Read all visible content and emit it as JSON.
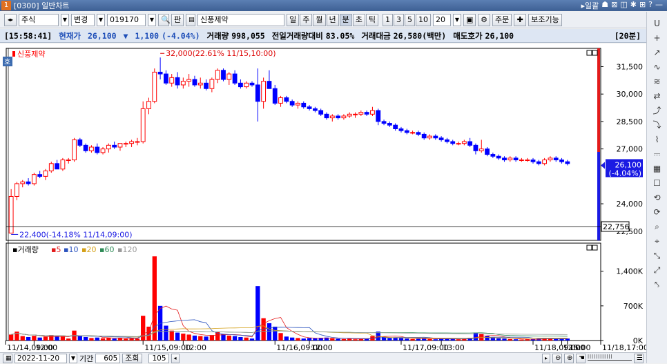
{
  "window": {
    "number": "1",
    "title": "[0300] 일반차트",
    "right_items": [
      "▸일괄",
      "☗",
      "⊠",
      "◫",
      "✱",
      "⊞",
      "?",
      "—"
    ]
  },
  "toolbar": {
    "arrows": "◂▸",
    "market_type": "주식",
    "change_label": "변경",
    "stock_code": "019170",
    "stock_name": "신풍제약",
    "pan_label": "판",
    "period_buttons": [
      "일",
      "주",
      "월",
      "년",
      "분",
      "초",
      "틱"
    ],
    "active_period": "분",
    "interval_buttons": [
      "1",
      "3",
      "5",
      "10"
    ],
    "interval_value": "20",
    "order_label": "주문",
    "aux_label": "보조기능"
  },
  "infobar": {
    "time": "[15:58:41]",
    "price_label": "현재가",
    "price": "26,100",
    "change_symbol": "▼",
    "change": "1,100",
    "change_pct": "(-4.04%)",
    "volume_label": "거래량",
    "volume": "998,055",
    "prev_vol_label": "전일거래량대비",
    "prev_vol": "83.05%",
    "amount_label": "거래대금",
    "amount": "26,580(백만)",
    "ask_label": "매도호가",
    "ask": "26,100",
    "interval_tag": "[20분]"
  },
  "chart": {
    "price_legend": "신풍제약",
    "high_annotation": "32,000(22.61% 11/15,10:00)",
    "low_annotation": "22,400(-14.18% 11/14,09:00)",
    "current_price_tag": "26,100",
    "current_pct_tag": "(-4.04%)",
    "crosshair_price": "22,756",
    "price_ticks": [
      "31,500",
      "30,000",
      "28,500",
      "27,000",
      "24,000",
      "22,500"
    ],
    "volume_legend": {
      "label": "거래량",
      "ma": [
        "5",
        "10",
        "20",
        "60",
        "120"
      ]
    },
    "volume_ticks": [
      "1,400K",
      "700K",
      "0K"
    ],
    "x_labels": [
      "11/14,09:00",
      "12:00",
      "11/15,09:00",
      "12:00",
      "11/16,09:00",
      "12:00",
      "11/17,09:00",
      "13:00",
      "11/18,09:00",
      "12:00",
      "15:00",
      "11/18,17:00"
    ]
  },
  "bottombar": {
    "date": "2022-11-20",
    "period_label": "기간",
    "period_value": "605",
    "query_label": "조회",
    "count_value": "105"
  },
  "colors": {
    "up": "#ff0000",
    "down": "#0000ff",
    "accent": "#1f4fb8"
  },
  "chart_data": {
    "type": "candlestick",
    "price_ylim": [
      22000,
      32500
    ],
    "volume_ylim": [
      0,
      1800000
    ],
    "candles": [
      [
        22400,
        24800,
        22400,
        24400,
        120000
      ],
      [
        24400,
        25200,
        24200,
        25100,
        180000
      ],
      [
        25100,
        25300,
        24900,
        25200,
        90000
      ],
      [
        25200,
        25400,
        25000,
        25100,
        70000
      ],
      [
        25100,
        25700,
        25000,
        25600,
        95000
      ],
      [
        25600,
        25800,
        25400,
        25500,
        60000
      ],
      [
        25500,
        25900,
        25300,
        25800,
        75000
      ],
      [
        25800,
        26300,
        25700,
        26200,
        110000
      ],
      [
        26200,
        26400,
        25900,
        25900,
        80000
      ],
      [
        25900,
        26500,
        25800,
        26400,
        85000
      ],
      [
        26400,
        26500,
        26200,
        26400,
        40000
      ],
      [
        26400,
        27600,
        26300,
        27500,
        200000
      ],
      [
        27500,
        27600,
        27100,
        27200,
        90000
      ],
      [
        27200,
        27300,
        26800,
        26900,
        70000
      ],
      [
        26900,
        27200,
        26800,
        27100,
        50000
      ],
      [
        27100,
        27300,
        26700,
        26800,
        60000
      ],
      [
        26800,
        27100,
        26700,
        27000,
        45000
      ],
      [
        27000,
        27300,
        26800,
        27200,
        55000
      ],
      [
        27200,
        27400,
        27000,
        27100,
        40000
      ],
      [
        27100,
        27300,
        26900,
        27300,
        50000
      ],
      [
        27300,
        27400,
        27100,
        27300,
        35000
      ],
      [
        27300,
        27500,
        27100,
        27400,
        45000
      ],
      [
        27400,
        27600,
        27200,
        27400,
        40000
      ],
      [
        27400,
        29600,
        27300,
        29200,
        500000
      ],
      [
        29200,
        29800,
        28900,
        29600,
        280000
      ],
      [
        29600,
        31400,
        29500,
        31200,
        1700000
      ],
      [
        31200,
        32000,
        30800,
        31100,
        700000
      ],
      [
        31100,
        31300,
        30500,
        30600,
        300000
      ],
      [
        30600,
        31100,
        30400,
        30900,
        200000
      ],
      [
        30900,
        31200,
        30300,
        30500,
        160000
      ],
      [
        30500,
        30900,
        30300,
        30700,
        140000
      ],
      [
        30700,
        31100,
        30400,
        30800,
        120000
      ],
      [
        30800,
        31000,
        30400,
        30500,
        100000
      ],
      [
        30500,
        30900,
        30300,
        30600,
        90000
      ],
      [
        30600,
        30800,
        30200,
        30300,
        80000
      ],
      [
        30300,
        30900,
        30100,
        30800,
        110000
      ],
      [
        30800,
        31400,
        30600,
        31300,
        170000
      ],
      [
        31300,
        31400,
        30700,
        30800,
        130000
      ],
      [
        30800,
        31200,
        30500,
        31100,
        100000
      ],
      [
        31100,
        31300,
        30500,
        30600,
        90000
      ],
      [
        30600,
        30800,
        30300,
        30400,
        70000
      ],
      [
        30400,
        30700,
        30300,
        30600,
        60000
      ],
      [
        30600,
        30700,
        30400,
        30500,
        40000
      ],
      [
        30500,
        31400,
        28500,
        29600,
        1100000
      ],
      [
        29600,
        30900,
        29200,
        30700,
        450000
      ],
      [
        30700,
        31300,
        30300,
        30300,
        350000
      ],
      [
        30300,
        30500,
        29400,
        29500,
        280000
      ],
      [
        29500,
        29900,
        29300,
        29800,
        150000
      ],
      [
        29800,
        29900,
        29500,
        29600,
        80000
      ],
      [
        29600,
        29700,
        29300,
        29400,
        60000
      ],
      [
        29400,
        29600,
        29200,
        29500,
        50000
      ],
      [
        29500,
        29600,
        29200,
        29300,
        40000
      ],
      [
        29300,
        29400,
        29100,
        29200,
        50000
      ],
      [
        29200,
        29300,
        29000,
        29100,
        45000
      ],
      [
        29100,
        29200,
        28800,
        28900,
        55000
      ],
      [
        28900,
        29000,
        28600,
        28700,
        60000
      ],
      [
        28700,
        28900,
        28500,
        28800,
        40000
      ],
      [
        28800,
        28900,
        28600,
        28700,
        35000
      ],
      [
        28700,
        28900,
        28600,
        28800,
        30000
      ],
      [
        28800,
        29000,
        28700,
        28900,
        40000
      ],
      [
        28900,
        29000,
        28700,
        28900,
        25000
      ],
      [
        28900,
        29100,
        28800,
        29000,
        30000
      ],
      [
        29000,
        29100,
        28800,
        28900,
        35000
      ],
      [
        28900,
        29300,
        28800,
        29100,
        90000
      ],
      [
        29100,
        29200,
        28300,
        28500,
        180000
      ],
      [
        28500,
        28600,
        28300,
        28400,
        70000
      ],
      [
        28400,
        28500,
        28200,
        28300,
        50000
      ],
      [
        28300,
        28400,
        28000,
        28100,
        60000
      ],
      [
        28100,
        28200,
        27900,
        28000,
        50000
      ],
      [
        28000,
        28100,
        27800,
        27900,
        40000
      ],
      [
        27900,
        28000,
        27800,
        27900,
        30000
      ],
      [
        27900,
        28000,
        27700,
        27800,
        35000
      ],
      [
        27800,
        27900,
        27500,
        27600,
        45000
      ],
      [
        27600,
        27800,
        27500,
        27700,
        30000
      ],
      [
        27700,
        27800,
        27500,
        27600,
        25000
      ],
      [
        27600,
        27700,
        27400,
        27500,
        35000
      ],
      [
        27500,
        27600,
        27300,
        27400,
        40000
      ],
      [
        27400,
        27500,
        27200,
        27300,
        30000
      ],
      [
        27300,
        27400,
        27200,
        27300,
        25000
      ],
      [
        27300,
        27500,
        27200,
        27400,
        30000
      ],
      [
        27400,
        27600,
        27100,
        27200,
        55000
      ],
      [
        27200,
        27300,
        26700,
        26900,
        160000
      ],
      [
        26900,
        27500,
        26800,
        27000,
        140000
      ],
      [
        27000,
        27100,
        26600,
        26700,
        90000
      ],
      [
        26700,
        26800,
        26500,
        26600,
        60000
      ],
      [
        26600,
        26700,
        26400,
        26500,
        45000
      ],
      [
        26500,
        26600,
        26300,
        26400,
        40000
      ],
      [
        26400,
        26600,
        26300,
        26500,
        30000
      ],
      [
        26500,
        26600,
        26300,
        26400,
        25000
      ],
      [
        26400,
        26500,
        26300,
        26400,
        20000
      ],
      [
        26400,
        26500,
        26300,
        26400,
        25000
      ],
      [
        26400,
        26500,
        26200,
        26300,
        30000
      ],
      [
        26300,
        26400,
        26100,
        26200,
        35000
      ],
      [
        26200,
        26500,
        26100,
        26400,
        50000
      ],
      [
        26400,
        26600,
        26300,
        26500,
        45000
      ],
      [
        26500,
        26600,
        26300,
        26400,
        30000
      ],
      [
        26400,
        26500,
        26200,
        26300,
        35000
      ],
      [
        26300,
        26400,
        26100,
        26200,
        40000
      ]
    ]
  }
}
